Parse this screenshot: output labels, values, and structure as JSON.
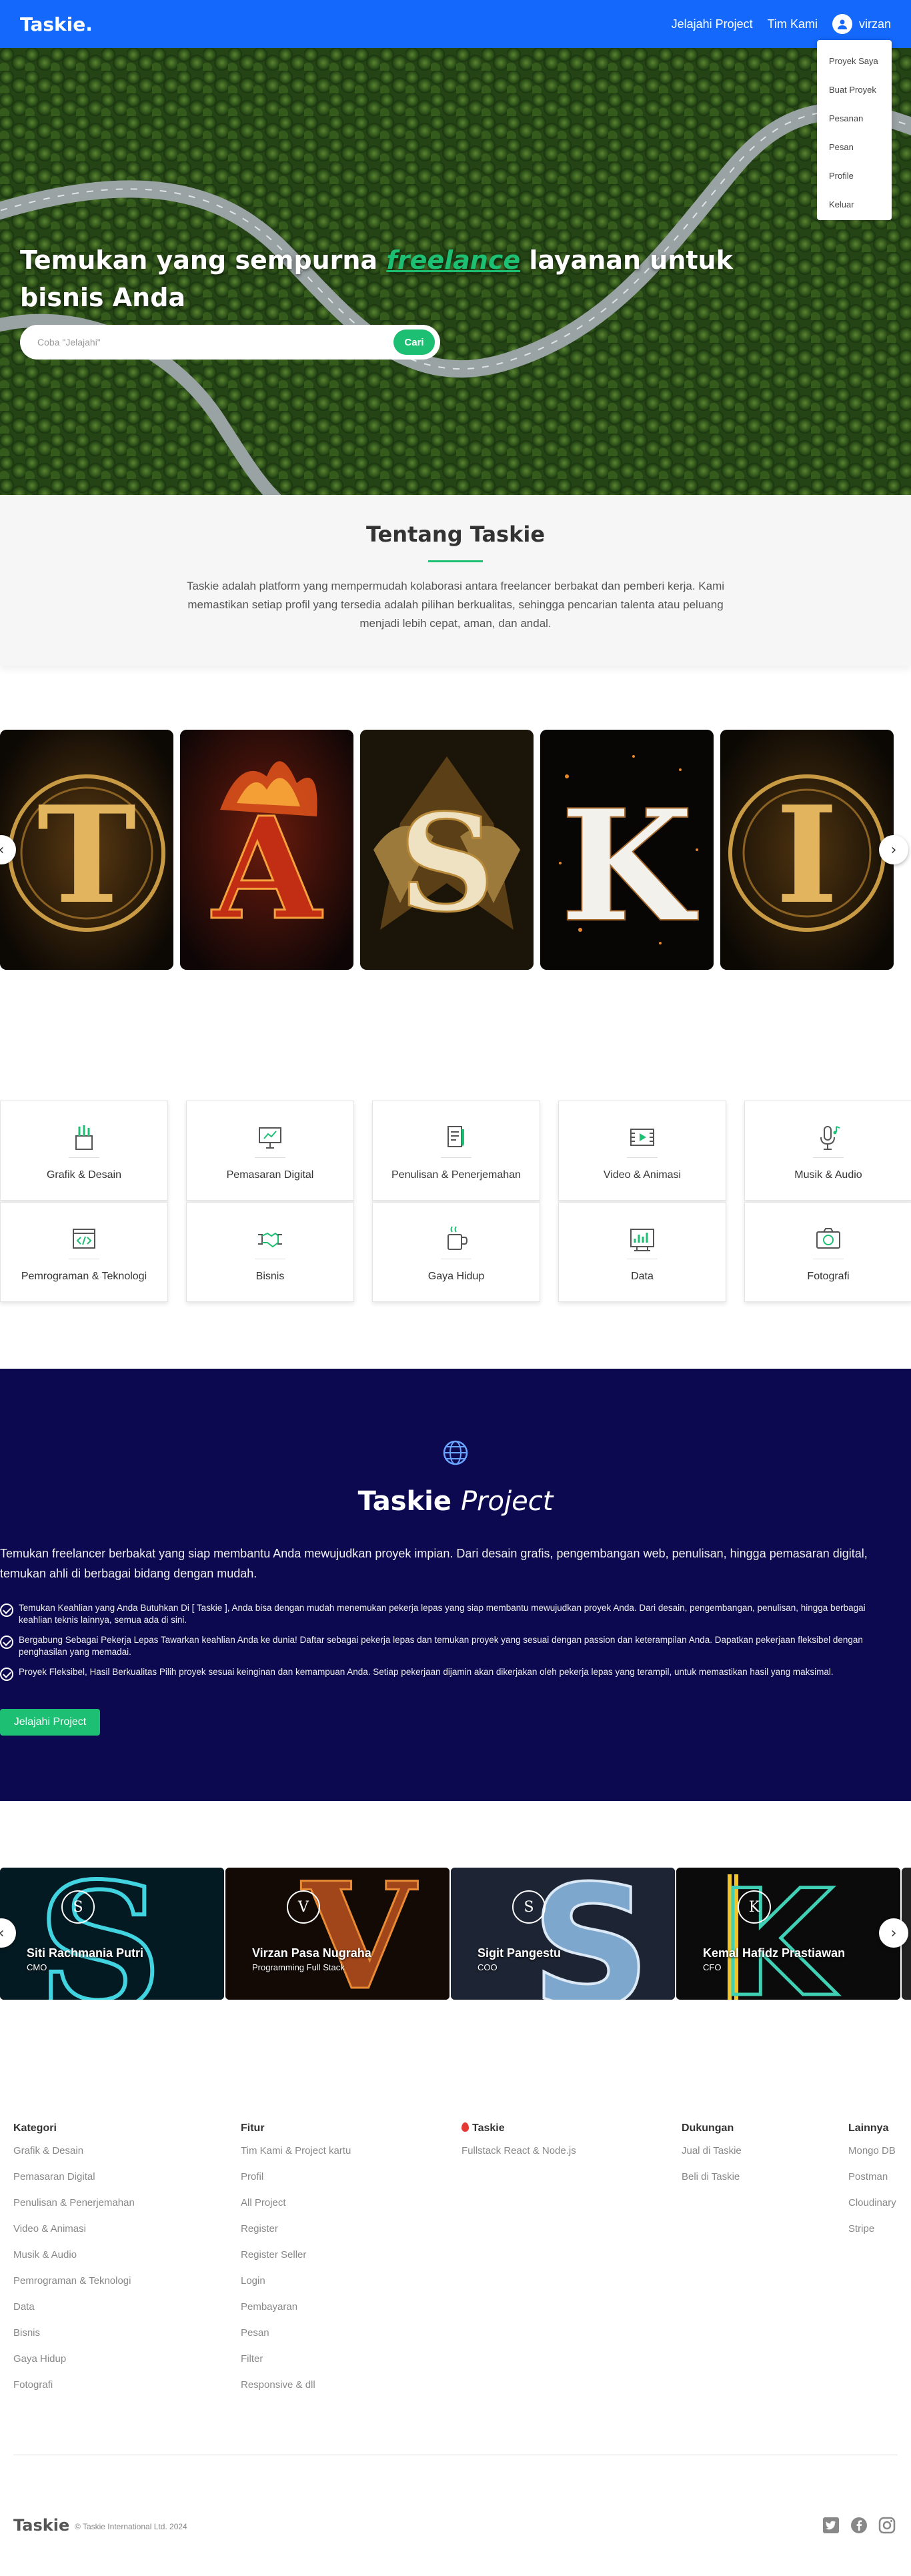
{
  "nav": {
    "logo": "Taskie",
    "logo_dot": ".",
    "links": [
      "Jelajahi Project",
      "Tim Kami"
    ],
    "username": "virzan",
    "dropdown": [
      "Proyek Saya",
      "Buat Proyek",
      "Pesanan",
      "Pesan",
      "Profile",
      "Keluar"
    ]
  },
  "hero": {
    "title_before": "Temukan yang sempurna ",
    "title_highlight": "freelance",
    "title_after": " layanan untuk bisnis Anda",
    "search_placeholder": "Coba \"Jelajahi\"",
    "search_button": "Cari"
  },
  "about": {
    "title": "Tentang Taskie",
    "text": "Taskie adalah platform yang mempermudah kolaborasi antara freelancer berbakat dan pemberi kerja. Kami memastikan setiap profil yang tersedia adalah pilihan berkualitas, sehingga pencarian talenta atau peluang menjadi lebih cepat, aman, dan andal."
  },
  "letters": [
    "T",
    "A",
    "S",
    "K",
    "I"
  ],
  "categories": [
    {
      "label": "Grafik & Desain",
      "icon": "design-icon"
    },
    {
      "label": "Pemasaran Digital",
      "icon": "monitor-icon"
    },
    {
      "label": "Penulisan & Penerjemahan",
      "icon": "document-icon"
    },
    {
      "label": "Video & Animasi",
      "icon": "film-icon"
    },
    {
      "label": "Musik & Audio",
      "icon": "microphone-icon"
    },
    {
      "label": "Pemrograman & Teknologi",
      "icon": "code-icon"
    },
    {
      "label": "Bisnis",
      "icon": "handshake-icon"
    },
    {
      "label": "Gaya Hidup",
      "icon": "coffee-icon"
    },
    {
      "label": "Data",
      "icon": "data-icon"
    },
    {
      "label": "Fotografi",
      "icon": "camera-icon"
    }
  ],
  "project": {
    "title_bold": "Taskie",
    "title_italic": "Project",
    "lead": "Temukan freelancer berbakat yang siap membantu Anda mewujudkan proyek impian. Dari desain grafis, pengembangan web, penulisan, hingga pemasaran digital, temukan ahli di berbagai bidang dengan mudah.",
    "points": [
      "Temukan Keahlian yang Anda Butuhkan Di [ Taskie ], Anda bisa dengan mudah menemukan pekerja lepas yang siap membantu mewujudkan proyek Anda. Dari desain, pengembangan, penulisan, hingga berbagai keahlian teknis lainnya, semua ada di sini.",
      "Bergabung Sebagai Pekerja Lepas Tawarkan keahlian Anda ke dunia! Daftar sebagai pekerja lepas dan temukan proyek yang sesuai dengan passion dan keterampilan Anda. Dapatkan pekerjaan fleksibel dengan penghasilan yang memadai.",
      "Proyek Fleksibel, Hasil Berkualitas Pilih proyek sesuai keinginan dan kemampuan Anda. Setiap pekerjaan dijamin akan dikerjakan oleh pekerja lepas yang terampil, untuk memastikan hasil yang maksimal."
    ],
    "button": "Jelajahi Project"
  },
  "team": [
    {
      "name": "Siti Rachmania Putri",
      "role": "CMO",
      "letter": "S"
    },
    {
      "name": "Virzan Pasa Nugraha",
      "role": "Programming Full Stack",
      "letter": "V"
    },
    {
      "name": "Sigit Pangestu",
      "role": "COO",
      "letter": "S"
    },
    {
      "name": "Kemal Hafidz Prastiawan",
      "role": "CFO",
      "letter": "K"
    }
  ],
  "footer": {
    "columns": [
      {
        "title": "Kategori",
        "items": [
          "Grafik & Desain",
          "Pemasaran Digital",
          "Penulisan & Penerjemahan",
          "Video & Animasi",
          "Musik & Audio",
          "Pemrograman & Teknologi",
          "Data",
          "Bisnis",
          "Gaya Hidup",
          "Fotografi"
        ]
      },
      {
        "title": "Fitur",
        "items": [
          "Tim Kami & Project kartu",
          "Profil",
          "All Project",
          "Register",
          "Register Seller",
          "Login",
          "Pembayaran",
          "Pesan",
          "Filter",
          "Responsive & dll"
        ]
      },
      {
        "title": "Taskie",
        "items": [
          "Fullstack React & Node.js"
        ]
      },
      {
        "title": "Dukungan",
        "items": [
          "Jual di Taskie",
          "Beli di Taskie"
        ]
      },
      {
        "title": "Lainnya",
        "items": [
          "Mongo DB",
          "Postman",
          "Cloudinary",
          "Stripe"
        ]
      }
    ],
    "brand": "Taskie",
    "copyright": "© Taskie International Ltd. 2024",
    "social": [
      "twitter-icon",
      "facebook-icon",
      "instagram-icon"
    ]
  },
  "colors": {
    "primary": "#1468fb",
    "accent": "#1dbf73",
    "project_bg": "#0d0950"
  }
}
